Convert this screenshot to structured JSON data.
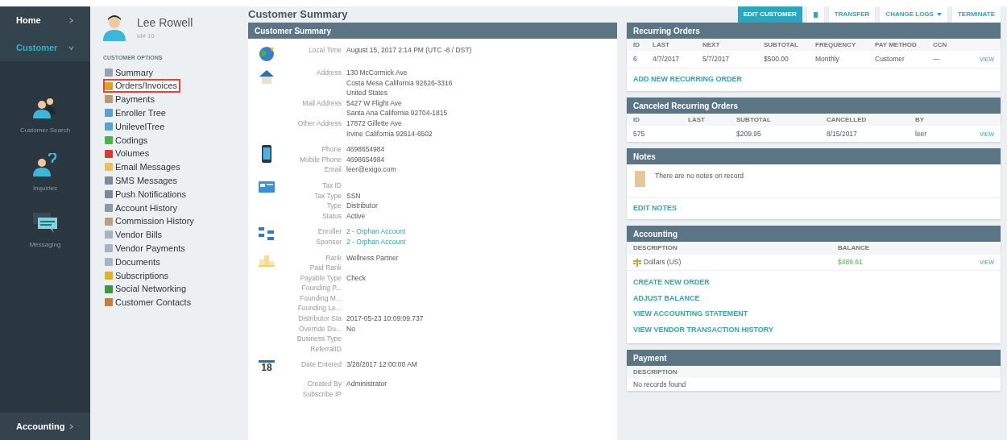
{
  "nav": {
    "top": [
      {
        "label": "Home",
        "expanded": false,
        "selected": false
      },
      {
        "label": "Customer",
        "expanded": true,
        "selected": true
      }
    ],
    "apps": [
      {
        "label": "Customer Search"
      },
      {
        "label": "Inquiries"
      },
      {
        "label": "Messaging"
      }
    ],
    "bottom": [
      {
        "label": "Accounting",
        "expanded": false,
        "selected": false
      }
    ]
  },
  "customer": {
    "name": "Lee Rowell",
    "id": "id# 10"
  },
  "options": {
    "title": "CUSTOMER OPTIONS",
    "items": [
      {
        "label": "Summary",
        "selected": false
      },
      {
        "label": "Orders/Invoices",
        "selected": true
      },
      {
        "label": "Payments",
        "selected": false
      },
      {
        "label": "Enroller Tree",
        "selected": false
      },
      {
        "label": "UnilevelTree",
        "selected": false
      },
      {
        "label": "Codings",
        "selected": false
      },
      {
        "label": "Volumes",
        "selected": false
      },
      {
        "label": "Email Messages",
        "selected": false
      },
      {
        "label": "SMS Messages",
        "selected": false
      },
      {
        "label": "Push Notifications",
        "selected": false
      },
      {
        "label": "Account History",
        "selected": false
      },
      {
        "label": "Commission History",
        "selected": false
      },
      {
        "label": "Vendor Bills",
        "selected": false
      },
      {
        "label": "Vendor Payments",
        "selected": false
      },
      {
        "label": "Documents",
        "selected": false
      },
      {
        "label": "Subscriptions",
        "selected": false
      },
      {
        "label": "Social Networking",
        "selected": false
      },
      {
        "label": "Customer Contacts",
        "selected": false
      }
    ]
  },
  "page_title": "Customer Summary",
  "actions": [
    {
      "label": "EDIT CUSTOMER",
      "kind": "primary"
    },
    {
      "kind": "icon"
    },
    {
      "label": "TRANSFER",
      "kind": "default",
      "dropdown": false
    },
    {
      "label": "CHANGE LOGS",
      "kind": "default",
      "dropdown": true
    },
    {
      "label": "TERMINATE",
      "kind": "default",
      "dropdown": false
    }
  ],
  "summary": {
    "title": "Customer Summary",
    "groups": [
      {
        "rows": [
          {
            "label": "Local Time",
            "value": [
              "August 15, 2017 2:14 PM (UTC -8 / DST)"
            ]
          }
        ]
      },
      {
        "rows": [
          {
            "label": "Address",
            "value": [
              "130 McCormick Ave",
              "Costa Mesa California 92626-3316",
              "United States"
            ]
          },
          {
            "label": "Mail Address",
            "value": [
              "5427 W Flight Ave",
              "Santa Ana California 92704-1815"
            ]
          },
          {
            "label": "Other Address",
            "value": [
              "17872 Gillette Ave",
              "Irvine California 92614-6502"
            ]
          }
        ]
      },
      {
        "rows": [
          {
            "label": "Phone",
            "value": [
              "4698654984"
            ]
          },
          {
            "label": "Mobile Phone",
            "value": [
              "4698654984"
            ]
          },
          {
            "label": "Email",
            "value": [
              "leer@exigo.com"
            ]
          }
        ]
      },
      {
        "rows": [
          {
            "label": "Tax ID"
          },
          {
            "label": "Tax Type",
            "value": [
              "SSN"
            ]
          },
          {
            "label": "Type",
            "value": [
              "Distributor"
            ]
          },
          {
            "label": "Status",
            "value": [
              "Active"
            ]
          }
        ]
      },
      {
        "rows": [
          {
            "label": "Enroller",
            "value": [
              "2 - Orphan Account"
            ],
            "link": true
          },
          {
            "label": "Sponsor",
            "value": [
              "2 - Orphan Account"
            ],
            "link": true
          }
        ]
      },
      {
        "rows": [
          {
            "label": "Rank",
            "value": [
              "Wellness Partner"
            ]
          },
          {
            "label": "Paid Rank"
          },
          {
            "label": "Payable Type",
            "value": [
              "Check"
            ]
          },
          {
            "label": "Founding P..."
          },
          {
            "label": "Founding M..."
          },
          {
            "label": "Founding Le..."
          },
          {
            "label": "Distributor Sta",
            "value": [
              "2017-05-23 10:09:09.737"
            ]
          },
          {
            "label": "Override Du...",
            "value": [
              "No"
            ]
          },
          {
            "label": "Business Type"
          },
          {
            "label": "ReferralID"
          }
        ]
      },
      {
        "icon_text": "18",
        "rows": [
          {
            "label": "Date Entered",
            "value": [
              "3/28/2017 12:00:00 AM"
            ]
          }
        ]
      },
      {
        "rows": [
          {
            "label": "Created By",
            "value": [
              "Administrator"
            ]
          },
          {
            "label": "Subscribe IP"
          }
        ]
      }
    ]
  },
  "recurring": {
    "title": "Recurring Orders",
    "columns": [
      "ID",
      "LAST",
      "NEXT",
      "SUBTOTAL",
      "FREQUENCY",
      "PAY METHOD",
      "CCN"
    ],
    "rows": [
      {
        "cells": [
          "6",
          "4/7/2017",
          "5/7/2017",
          "$500.00",
          "Monthly",
          "Customer",
          "—"
        ],
        "link": "VIEW"
      }
    ],
    "footer_link": "ADD NEW RECURRING ORDER"
  },
  "canceled": {
    "title": "Canceled Recurring Orders",
    "columns": [
      "ID",
      "LAST",
      "SUBTOTAL",
      "CANCELLED",
      "BY"
    ],
    "rows": [
      {
        "cells": [
          "575",
          "",
          "$209.95",
          "8/15/2017",
          "leer"
        ],
        "link": "VIEW"
      }
    ]
  },
  "notes": {
    "title": "Notes",
    "message": "There are no notes on record",
    "link": "EDIT NOTES"
  },
  "accounting": {
    "title": "Accounting",
    "columns": [
      "DESCRIPTION",
      "BALANCE"
    ],
    "rows": [
      {
        "description": "Dollars (US)",
        "balance": "$489.61",
        "link": "VIEW"
      }
    ],
    "links": [
      "CREATE NEW ORDER",
      "ADJUST BALANCE",
      "VIEW ACCOUNTING STATEMENT",
      "VIEW VENDOR TRANSACTION HISTORY"
    ]
  },
  "payment": {
    "title": "Payment",
    "columns": [
      "DESCRIPTION"
    ],
    "empty": "No records found"
  }
}
